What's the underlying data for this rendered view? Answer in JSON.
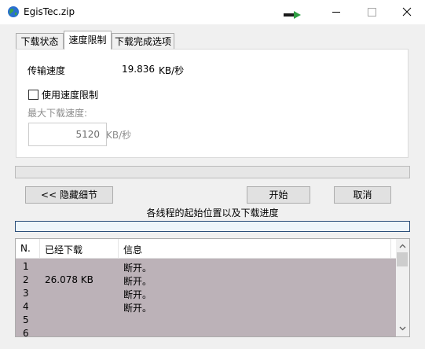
{
  "window": {
    "title": "EgisTec.zip"
  },
  "tabs": [
    {
      "label": "下载状态"
    },
    {
      "label": "速度限制",
      "active": true
    },
    {
      "label": "下载完成选项"
    }
  ],
  "speed": {
    "rate_label": "传输速度",
    "rate_value": "19.836",
    "rate_unit": "KB/秒",
    "limit_checkbox_label": "使用速度限制",
    "limit_checked": false,
    "max_label": "最大下载速度:",
    "max_value": "5120",
    "max_unit": "KB/秒"
  },
  "buttons": {
    "hide_details": "<< 隐藏细节",
    "start": "开始",
    "cancel": "取消"
  },
  "threads_caption": "各线程的起始位置以及下载进度",
  "list": {
    "columns": [
      "N.",
      "已经下载",
      "信息"
    ],
    "rows": [
      {
        "n": "1",
        "downloaded": "",
        "info": "断开。"
      },
      {
        "n": "2",
        "downloaded": "26.078  KB",
        "info": "断开。"
      },
      {
        "n": "3",
        "downloaded": "",
        "info": "断开。"
      },
      {
        "n": "4",
        "downloaded": "",
        "info": "断开。"
      },
      {
        "n": "5",
        "downloaded": "",
        "info": ""
      },
      {
        "n": "6",
        "downloaded": "",
        "info": ""
      }
    ]
  },
  "colors": {
    "list_row_background": "#bcb2b8",
    "window_background": "#f0f0f0",
    "panel_background": "#ffffff",
    "progress_border": "#2b4f7a"
  },
  "icons": [
    "globe-app-icon",
    "download-arrow-icon",
    "minimize-icon",
    "maximize-icon",
    "close-icon",
    "checkbox",
    "scroll-up-icon",
    "scroll-down-icon"
  ]
}
